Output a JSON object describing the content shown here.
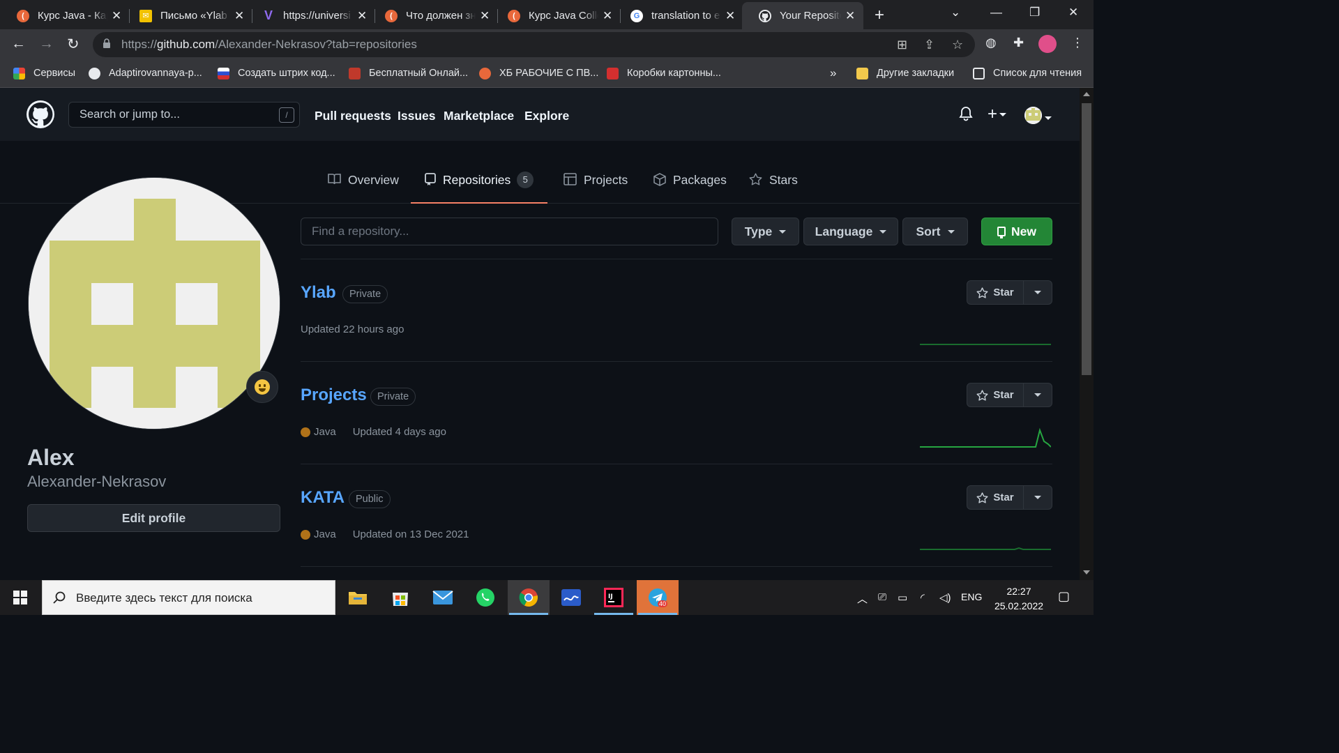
{
  "browser": {
    "tabs": [
      {
        "title": "Курс Java - Кар",
        "favicon_color": "#e8683b",
        "active": false
      },
      {
        "title": "Письмо «Ylab",
        "favicon_color": "#f2c200",
        "active": false
      },
      {
        "title": "https://universi",
        "favicon_color": "#6f4bd8",
        "active": false
      },
      {
        "title": "Что должен зн",
        "favicon_color": "#e8683b",
        "active": false
      },
      {
        "title": "Курс Java Colle",
        "favicon_color": "#e8683b",
        "active": false
      },
      {
        "title": "translation to e",
        "favicon_color": "#ffffff",
        "active": false
      },
      {
        "title": "Your Repositor",
        "favicon_color": "#e8eaed",
        "active": true
      }
    ],
    "url_prefix": "https://",
    "url_host": "github.com",
    "url_path": "/Alexander-Nekrasov?tab=repositories",
    "bookmarks": [
      {
        "label": "Сервисы",
        "color": "#e94235"
      },
      {
        "label": "Adaptirovannaya-p...",
        "color": "#e8eaed"
      },
      {
        "label": "Создать штрих код...",
        "color": "#2c4fd1"
      },
      {
        "label": "Бесплатный Онлай...",
        "color": "#c0392b"
      },
      {
        "label": "ХБ РАБОЧИЕ С ПВ...",
        "color": "#e8683b"
      },
      {
        "label": "Коробки картонны...",
        "color": "#d32f2f"
      }
    ],
    "bookmarks_more": "»",
    "other_bookmarks": "Другие закладки",
    "reading_list": "Список для чтения"
  },
  "github": {
    "search_placeholder": "Search or jump to...",
    "search_shortcut": "/",
    "nav": [
      "Pull requests",
      "Issues",
      "Marketplace",
      "Explore"
    ],
    "profile_tabs": [
      {
        "label": "Overview",
        "icon": "book-icon"
      },
      {
        "label": "Repositories",
        "icon": "repo-icon",
        "count": "5",
        "selected": true
      },
      {
        "label": "Projects",
        "icon": "table-icon"
      },
      {
        "label": "Packages",
        "icon": "package-icon"
      },
      {
        "label": "Stars",
        "icon": "star-icon"
      }
    ],
    "user": {
      "name": "Alex",
      "login": "Alexander-Nekrasov",
      "edit_profile": "Edit profile",
      "avatar_color": "#cccc77"
    },
    "filters": {
      "find_placeholder": "Find a repository...",
      "type": "Type",
      "language": "Language",
      "sort": "Sort",
      "new": "New"
    },
    "repos": [
      {
        "name": "Ylab",
        "visibility": "Private",
        "language": "",
        "updated": "Updated 22 hours ago",
        "star": "Star"
      },
      {
        "name": "Projects",
        "visibility": "Private",
        "language": "Java",
        "updated": "Updated 4 days ago",
        "star": "Star"
      },
      {
        "name": "KATA",
        "visibility": "Public",
        "language": "Java",
        "updated": "Updated on 13 Dec 2021",
        "star": "Star"
      }
    ],
    "colors": {
      "accent_green": "#238636",
      "link_blue": "#58a6ff",
      "java_dot": "#b07219",
      "tab_underline": "#f78166"
    }
  },
  "taskbar": {
    "search_placeholder": "Введите здесь текст для поиска",
    "language": "ENG",
    "time": "22:27",
    "date": "25.02.2022",
    "telegram_badge": "40"
  }
}
